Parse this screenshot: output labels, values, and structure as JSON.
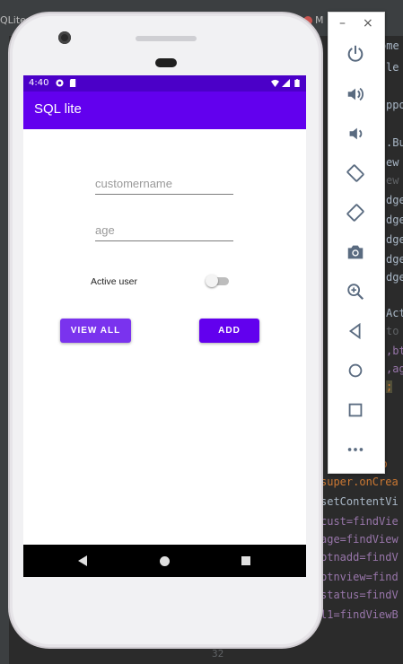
{
  "ide": {
    "tab_left": "QLite",
    "tab_right": "M",
    "gutter_line_number": "32",
    "code_lines": [
      {
        "text": "ome"
      },
      {
        "text": "le"
      },
      {
        "text": "ppo"
      },
      {
        "text": ".Bu"
      },
      {
        "text": "ew"
      },
      {
        "text": "ew"
      },
      {
        "text": "dge"
      },
      {
        "text": "dge"
      },
      {
        "text": "dge"
      },
      {
        "text": "dge"
      },
      {
        "text": "dge"
      },
      {
        "text": "Act"
      },
      {
        "text": "to"
      },
      {
        "text": ",bt"
      },
      {
        "text": ",ag"
      },
      {
        "text": ";"
      },
      {
        "text": "d o"
      },
      {
        "text": "super.onCrea"
      },
      {
        "text": "setContentVi"
      },
      {
        "text": "cust=findVie"
      },
      {
        "text": "age=findView"
      },
      {
        "text": "btnadd=findV"
      },
      {
        "text": "btnview=find"
      },
      {
        "text": "status=findV"
      },
      {
        "text": "l1=findViewB"
      }
    ]
  },
  "device": {
    "status_bar": {
      "time": "4:40"
    },
    "app_bar": {
      "title": "SQL lite"
    },
    "form": {
      "customername_placeholder": "customername",
      "age_placeholder": "age",
      "active_user_label": "Active user",
      "active_user_on": false
    },
    "buttons": {
      "view_all": "VIEW ALL",
      "add": "ADD"
    }
  },
  "emulator_toolbar": {
    "minimize": "–",
    "close": "×",
    "icons": [
      "power-icon",
      "volume-up-icon",
      "volume-down-icon",
      "rotate-left-icon",
      "rotate-right-icon",
      "camera-icon",
      "zoom-icon",
      "back-icon",
      "home-icon",
      "overview-icon",
      "more-icon"
    ]
  },
  "colors": {
    "primary": "#6200ee",
    "primary_dark": "#4b00c8",
    "view_all_button": "#7a33ee"
  }
}
